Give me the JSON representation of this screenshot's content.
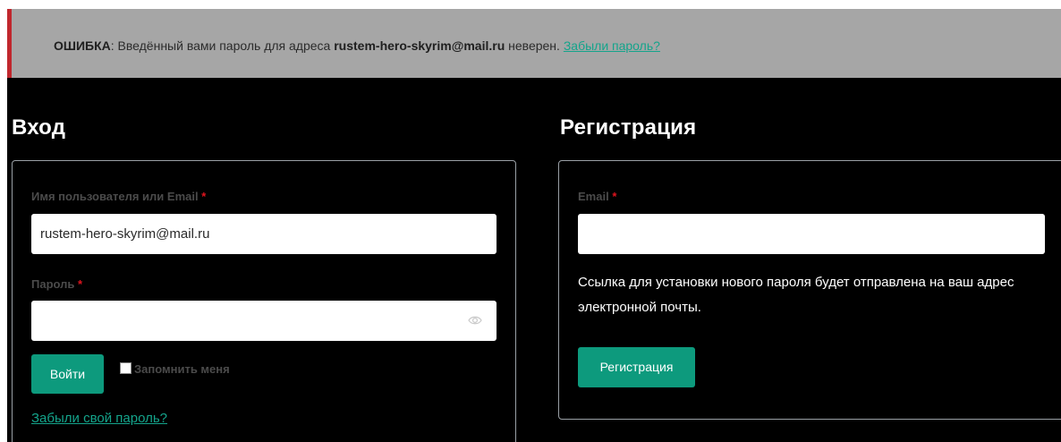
{
  "notice": {
    "error_label": "ОШИБКА",
    "message_before": ": Введённый вами пароль для адреса ",
    "email": "rustem-hero-skyrim@mail.ru",
    "message_after": " неверен. ",
    "forgot_link": "Забыли пароль?",
    "accent_color": "#c0272d"
  },
  "login": {
    "heading": "Вход",
    "username_label": "Имя пользователя или Email",
    "username_value": "rustem-hero-skyrim@mail.ru",
    "password_label": "Пароль",
    "password_value": "",
    "submit_label": "Войти",
    "remember_label": "Запомнить меня",
    "forgot_link": "Забыли свой пароль?",
    "required_mark": "*"
  },
  "register": {
    "heading": "Регистрация",
    "email_label": "Email",
    "email_value": "",
    "info": "Ссылка для установки нового пароля будет отправлена на ваш адрес электронной почты.",
    "submit_label": "Регистрация",
    "required_mark": "*"
  },
  "icons": {
    "password_visibility": "eye-icon"
  },
  "colors": {
    "accent": "#0d9a7d",
    "link": "#14a48b",
    "background": "#000000",
    "notice_bg": "#a6a6a6"
  }
}
